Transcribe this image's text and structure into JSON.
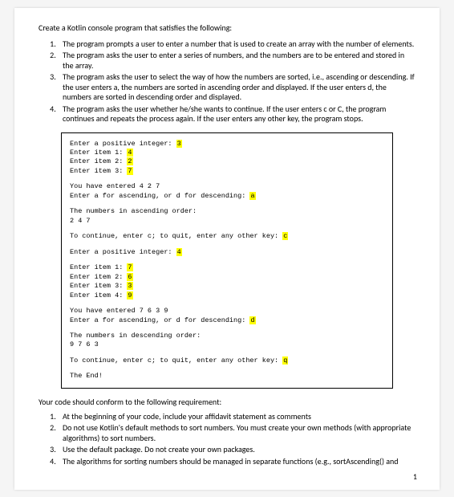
{
  "intro": "Create a Kotlin console program that satisfies the following:",
  "requirements": [
    "The program prompts a user to enter a number that is used to create an array with the number of elements.",
    "The program asks the user to enter a series of numbers, and the numbers are to be entered and stored in the array.",
    "The program asks the user to select the way of how the numbers are sorted, i.e., ascending or descending. If the user enters a, the numbers are sorted in ascending order and displayed. If the user enters d, the numbers are sorted in descending order and displayed.",
    "The program asks the user whether he/she wants to continue. If the user enters c or C, the program continues and repeats the process again. If the user enters any other key, the program stops."
  ],
  "console": {
    "run1": {
      "prompt_size": "Enter a positive integer: ",
      "size_val": "3",
      "item1": "Enter item 1: ",
      "item1_val": "4",
      "item2": "Enter item 2: ",
      "item2_val": "2",
      "item3": "Enter item 3: ",
      "item3_val": "7",
      "entered": "You have entered 4 2 7",
      "sort_prompt": "Enter a for ascending, or d for descending: ",
      "sort_val": "a",
      "sorted_label": "The numbers in ascending order:",
      "sorted_vals": "2 4 7",
      "cont_prompt": "To continue, enter c; to quit, enter any other key: ",
      "cont_val": "c"
    },
    "run2": {
      "prompt_size": "Enter a positive integer: ",
      "size_val": "4",
      "item1": "Enter item 1: ",
      "item1_val": "7",
      "item2": "Enter item 2: ",
      "item2_val": "6",
      "item3": "Enter item 3: ",
      "item3_val": "3",
      "item4": "Enter item 4: ",
      "item4_val": "9",
      "entered": "You have entered 7 6 3 9",
      "sort_prompt": "Enter a for ascending, or d for descending: ",
      "sort_val": "d",
      "sorted_label": "The numbers in descending order:",
      "sorted_vals": "9 7 6 3",
      "cont_prompt": "To continue, enter c; to quit, enter any other key: ",
      "cont_val": "q",
      "end": "The End!"
    }
  },
  "follow_intro": "Your code should conform to the following requirement:",
  "follow_reqs": [
    "At the beginning of your code, include your affidavit statement as comments",
    "Do not use Kotlin's default methods to sort numbers. You must create your own methods (with appropriate algorithms) to sort numbers.",
    "Use the default package. Do not create your own packages.",
    "The algorithms for sorting numbers should be managed in separate functions (e.g., sortAscending() and"
  ],
  "page_number": "1"
}
